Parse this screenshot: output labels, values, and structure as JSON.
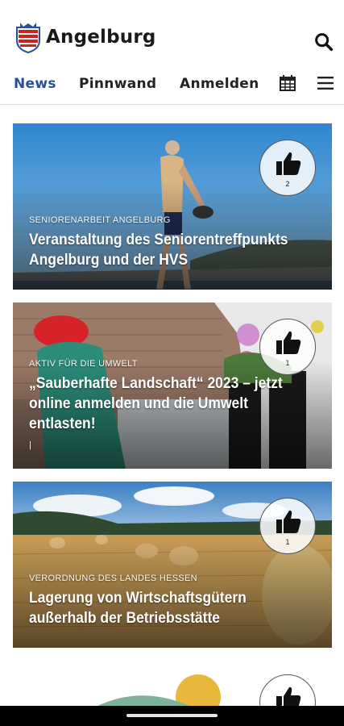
{
  "header": {
    "app_title": "Angelburg",
    "crest_icon": "hessen-crest-icon",
    "search_icon": "search-icon"
  },
  "tabs": [
    {
      "label": "News",
      "active": true
    },
    {
      "label": "Pinnwand",
      "active": false
    },
    {
      "label": "Anmelden",
      "active": false
    }
  ],
  "toolbar": {
    "calendar_icon": "calendar-icon",
    "menu_icon": "hamburger-menu-icon"
  },
  "colors": {
    "accent": "#2a4f9a",
    "text": "#222222"
  },
  "cards": [
    {
      "category": "SENIORENARBEIT ANGELBURG",
      "title": "Veranstaltung des Seniorentreffpunkts Angelburg und der HVS",
      "extra": "",
      "likes": "2",
      "like_icon": "thumbs-up-icon"
    },
    {
      "category": "AKTIV FÜR DIE UMWELT",
      "title": "„Sauberhafte Landschaft“ 2023 – jetzt online anmelden und die Umwelt entlasten!",
      "extra": "|",
      "likes": "1",
      "like_icon": "thumbs-up-icon"
    },
    {
      "category": "VERORDNUNG DES LANDES HESSEN",
      "title": "Lagerung von Wirtschaftsgütern außerhalb der Betriebsstätte",
      "extra": "",
      "likes": "1",
      "like_icon": "thumbs-up-icon"
    },
    {
      "category": "",
      "title": "",
      "extra": "",
      "likes": "",
      "like_icon": "thumbs-up-icon"
    }
  ]
}
